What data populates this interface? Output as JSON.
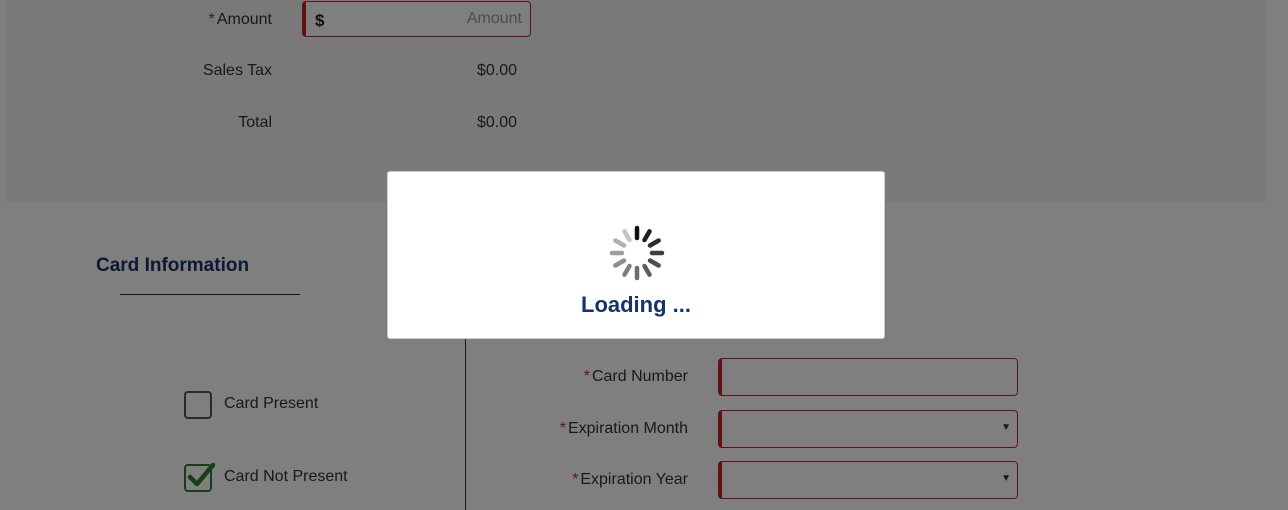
{
  "payment": {
    "amount_label": "Amount",
    "amount_currency": "$",
    "amount_placeholder": "Amount",
    "amount_value": "",
    "sales_tax_label": "Sales Tax",
    "sales_tax_value": "$0.00",
    "total_label": "Total",
    "total_value": "$0.00"
  },
  "card_info": {
    "title": "Card Information",
    "card_present_label": "Card Present",
    "card_present_checked": false,
    "card_not_present_label": "Card Not Present",
    "card_not_present_checked": true,
    "card_number_label": "Card Number",
    "card_number_value": "",
    "expiration_month_label": "Expiration Month",
    "expiration_month_value": "",
    "expiration_year_label": "Expiration Year",
    "expiration_year_value": ""
  },
  "required_marker": "*",
  "loading": {
    "text": "Loading ..."
  },
  "icons": {
    "spinner": "spinner-icon",
    "checkmark": "checkmark-icon",
    "dropdown": "chevron-down-icon"
  },
  "colors": {
    "required": "#c1272d",
    "heading": "#16336b",
    "check": "#2e7d32",
    "overlay": "rgba(0,0,0,0.5)"
  }
}
